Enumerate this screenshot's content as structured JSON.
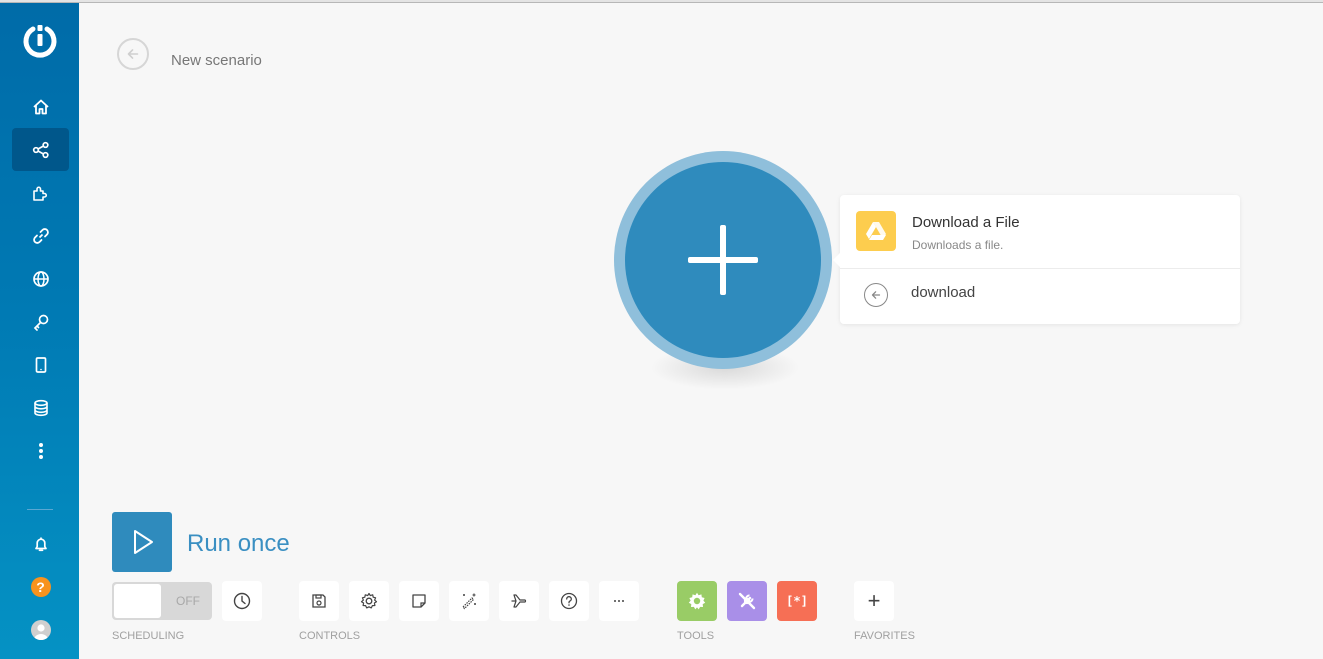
{
  "header": {
    "title": "New scenario",
    "back_icon": "arrow-left-circle-icon"
  },
  "sidebar": {
    "logo": "integromat-power-logo",
    "items": [
      {
        "name": "home",
        "icon": "home-icon",
        "active": false
      },
      {
        "name": "scenarios",
        "icon": "share-nodes-icon",
        "active": true
      },
      {
        "name": "templates",
        "icon": "puzzle-icon",
        "active": false
      },
      {
        "name": "connections",
        "icon": "link-icon",
        "active": false
      },
      {
        "name": "webhooks",
        "icon": "globe-icon",
        "active": false
      },
      {
        "name": "keys",
        "icon": "key-icon",
        "active": false
      },
      {
        "name": "devices",
        "icon": "mobile-icon",
        "active": false
      },
      {
        "name": "data-stores",
        "icon": "database-icon",
        "active": false
      },
      {
        "name": "more",
        "icon": "more-vertical-icon",
        "active": false
      }
    ],
    "bottom": [
      {
        "name": "notifications",
        "icon": "bell-icon"
      },
      {
        "name": "help",
        "icon": "help-icon",
        "text": "?",
        "color": "#f7931e"
      },
      {
        "name": "profile",
        "icon": "avatar-icon"
      }
    ]
  },
  "canvas": {
    "add_module_icon": "plus-icon",
    "module_color": "#2f8bbd",
    "module_ring_color": "#8fbfdb"
  },
  "popup": {
    "items": [
      {
        "title": "Download a File",
        "subtitle": "Downloads a file.",
        "icon": "google-drive-icon",
        "icon_color": "#fdcd4e"
      }
    ],
    "back": {
      "label": "download",
      "icon": "arrow-left-circle-icon"
    }
  },
  "run": {
    "label": "Run once",
    "icon": "play-icon"
  },
  "scheduling": {
    "toggle_state": "OFF",
    "label": "SCHEDULING",
    "clock_icon": "clock-icon"
  },
  "controls": {
    "label": "CONTROLS",
    "buttons": [
      {
        "name": "save",
        "icon": "save-icon"
      },
      {
        "name": "settings",
        "icon": "gear-icon"
      },
      {
        "name": "notes",
        "icon": "note-icon"
      },
      {
        "name": "auto-align",
        "icon": "magic-wand-icon"
      },
      {
        "name": "explain-flow",
        "icon": "airplane-icon"
      },
      {
        "name": "help",
        "icon": "question-circle-icon"
      },
      {
        "name": "more",
        "icon": "ellipsis-icon",
        "text": "···"
      }
    ]
  },
  "tools": {
    "label": "TOOLS",
    "buttons": [
      {
        "name": "flow-control",
        "icon": "gear-icon",
        "color": "#99cc66"
      },
      {
        "name": "tools",
        "icon": "wrench-cross-icon",
        "color": "#a98fe8"
      },
      {
        "name": "text-parser",
        "icon": "brackets-icon",
        "text": "[*]",
        "color": "#f66f55"
      }
    ]
  },
  "favorites": {
    "label": "FAVORITES",
    "add_text": "+"
  }
}
